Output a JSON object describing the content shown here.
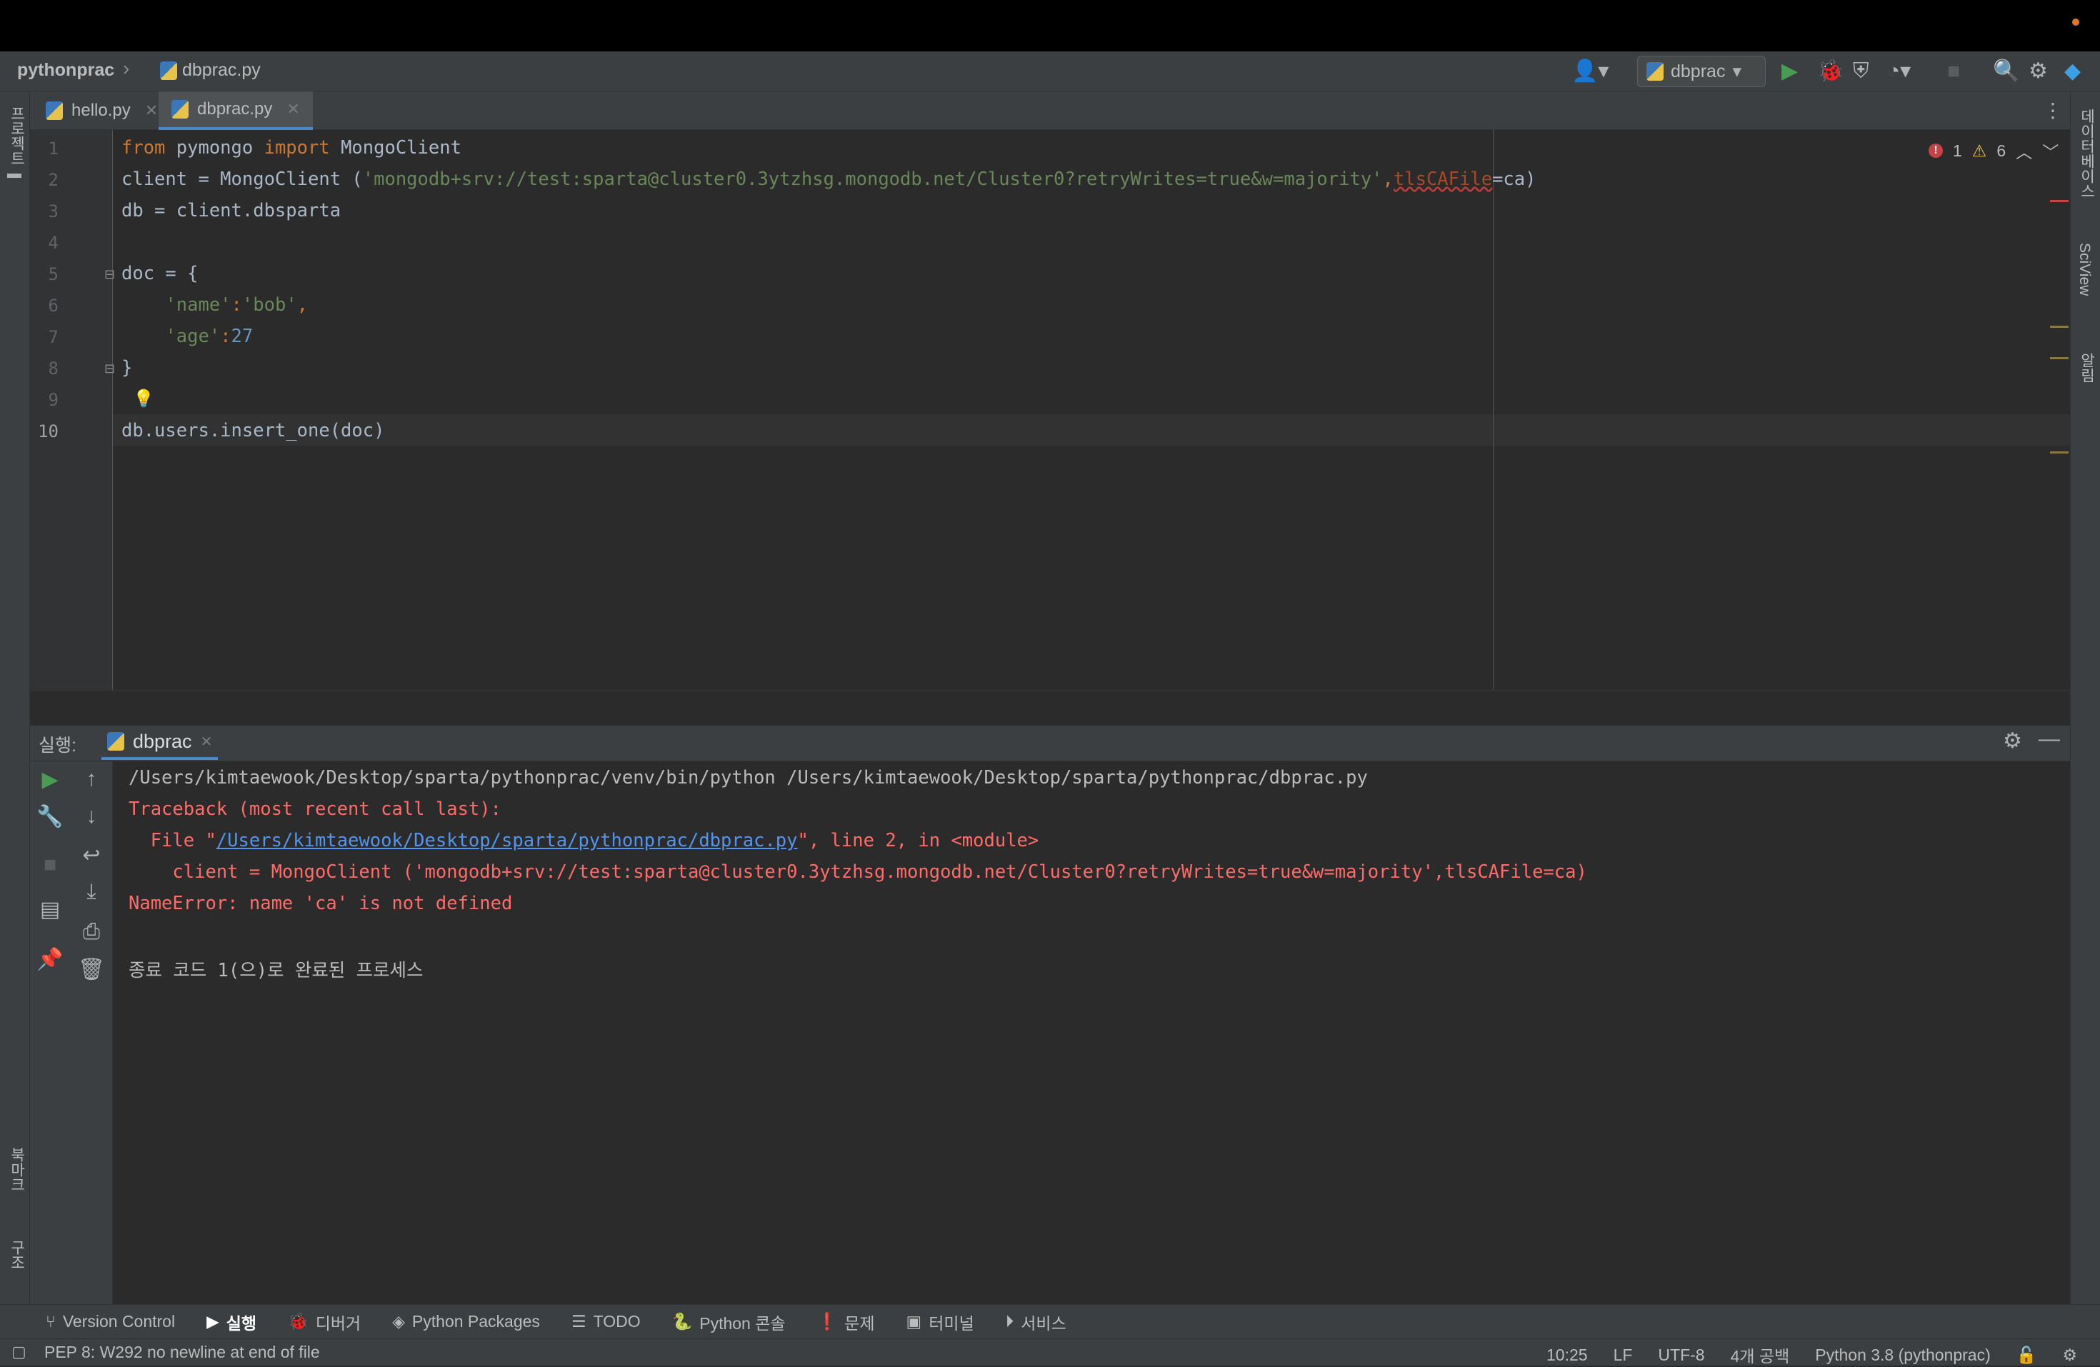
{
  "breadcrumb": {
    "project": "pythonprac",
    "file": "dbprac.py"
  },
  "run_config": {
    "name": "dbprac"
  },
  "tabs": [
    {
      "label": "hello.py",
      "active": false
    },
    {
      "label": "dbprac.py",
      "active": true
    }
  ],
  "left_strip": {
    "project": "프로젝트",
    "bookmarks": "북마크",
    "structure": "구조"
  },
  "right_strip": {
    "database": "데이터베이스",
    "sciview": "SciView",
    "notifications": "알림"
  },
  "inspections": {
    "errors": "1",
    "warnings": "6"
  },
  "editor": {
    "line_numbers": [
      "1",
      "2",
      "3",
      "4",
      "5",
      "6",
      "7",
      "8",
      "9",
      "10"
    ],
    "line1": {
      "kw1": "from",
      "mod": " pymongo ",
      "kw2": "import",
      "rest": " MongoClient"
    },
    "line2": {
      "pre": "client = MongoClient (",
      "str": "'mongodb+srv://test:sparta@cluster0.3ytzhsg.mongodb.net/Cluster0?retryWrites=true&w=majority'",
      "comma": ",",
      "param": "tlsCAFile",
      "post": "=ca)"
    },
    "line3": "db = client.dbsparta",
    "line5": "doc = {",
    "line6": {
      "key": "'name'",
      "colon": ":",
      "val": "'bob'",
      "comma": ","
    },
    "line7": {
      "key": "'age'",
      "colon": ":",
      "val": "27"
    },
    "line8": "}",
    "line10": "db.users.insert_one(doc)"
  },
  "run_panel": {
    "label": "실행:",
    "tab": "dbprac",
    "console": {
      "cmd": "/Users/kimtaewook/Desktop/sparta/pythonprac/venv/bin/python /Users/kimtaewook/Desktop/sparta/pythonprac/dbprac.py",
      "tb1": "Traceback (most recent call last):",
      "tb2_pre": "  File \"",
      "tb2_link": "/Users/kimtaewook/Desktop/sparta/pythonprac/dbprac.py",
      "tb2_post": "\", line 2, in <module>",
      "tb3": "    client = MongoClient ('mongodb+srv://test:sparta@cluster0.3ytzhsg.mongodb.net/Cluster0?retryWrites=true&w=majority',tlsCAFile=ca)",
      "tb4": "NameError: name 'ca' is not defined",
      "exit": "종료 코드 1(으)로 완료된 프로세스"
    }
  },
  "toolwindow_bar": {
    "vcs": "Version Control",
    "run": "실행",
    "debug": "디버거",
    "packages": "Python Packages",
    "todo": "TODO",
    "console": "Python 콘솔",
    "problems": "문제",
    "terminal": "터미널",
    "services": "서비스"
  },
  "status": {
    "message": "PEP 8: W292 no newline at end of file",
    "position": "10:25",
    "line_sep": "LF",
    "encoding": "UTF-8",
    "indent": "4개 공백",
    "interpreter": "Python 3.8 (pythonprac)"
  },
  "colors": {
    "accent": "#4a88c7",
    "error": "#ff6b68",
    "run_green": "#499c54"
  }
}
